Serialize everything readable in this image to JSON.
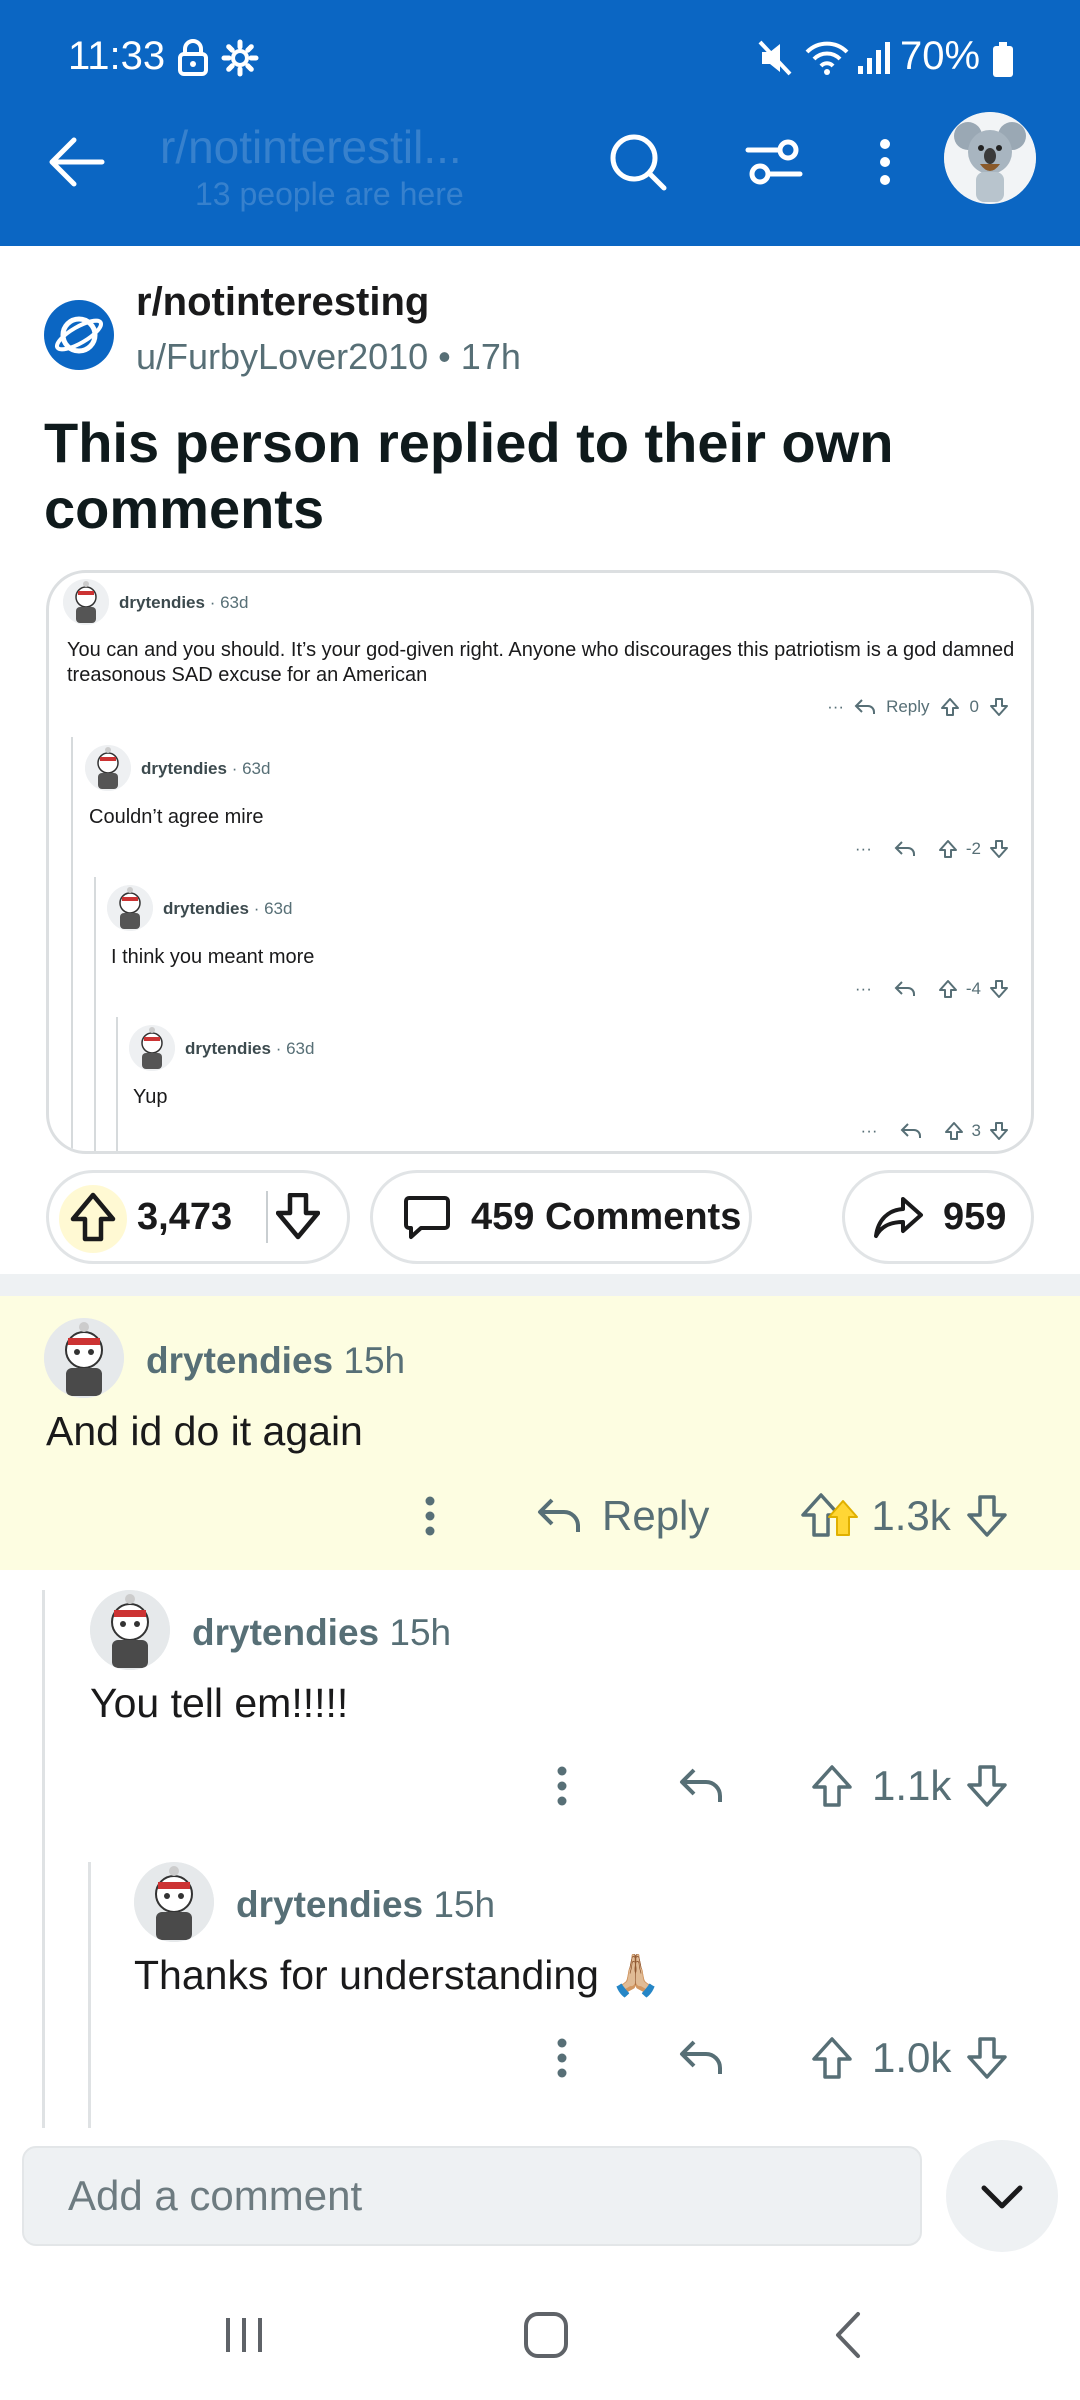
{
  "status": {
    "time": "11:33",
    "battery": "70%"
  },
  "header": {
    "title": "r/notinterestil...",
    "subtitle": "13 people are here"
  },
  "post": {
    "subreddit": "r/notinteresting",
    "author_line": "u/FurbyLover2010 • 17h",
    "title": "This person replied to their own comments",
    "upvotes": "3,473",
    "comments_label": "459 Comments",
    "shares": "959"
  },
  "embed": {
    "comments": [
      {
        "user": "drytendies",
        "age": "· 63d",
        "text": "You can and you should. It’s your god-given right. Anyone who discourages this patriotism is a god damned treasonous SAD excuse for an American",
        "reply": "Reply",
        "score": "0",
        "more": "···"
      },
      {
        "user": "drytendies",
        "age": "· 63d",
        "text": "Couldn’t agree mire",
        "score": "-2",
        "more": "···"
      },
      {
        "user": "drytendies",
        "age": "· 63d",
        "text": "I think you meant more",
        "score": "-4",
        "more": "···"
      },
      {
        "user": "drytendies",
        "age": "· 63d",
        "text": "Yup",
        "score": "3",
        "more": "···"
      }
    ]
  },
  "comments": [
    {
      "user": "drytendies",
      "age": "15h",
      "text": "And id do it again",
      "reply": "Reply",
      "score": "1.3k"
    },
    {
      "user": "drytendies",
      "age": "15h",
      "text": "You tell em!!!!!",
      "score": "1.1k"
    },
    {
      "user": "drytendies",
      "age": "15h",
      "text": "Thanks for understanding 🙏🏼",
      "score": "1.0k"
    }
  ],
  "composer": {
    "placeholder": "Add a comment"
  },
  "colors": {
    "brand_blue": "#0b66c3",
    "highlight": "#fdfde1",
    "upvote_gold": "#ffd635"
  }
}
